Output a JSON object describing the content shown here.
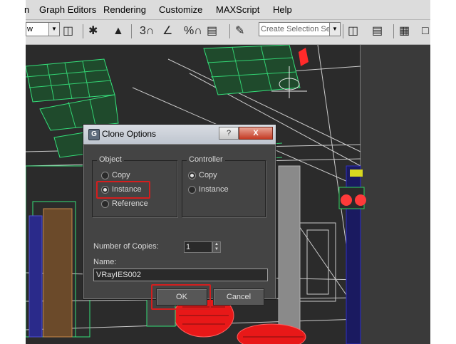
{
  "menu": {
    "items": [
      "n",
      "Graph Editors",
      "Rendering",
      "Customize",
      "MAXScript",
      "Help"
    ]
  },
  "toolbar": {
    "left_dropdown_value": "w",
    "selection_set_value": "Create Selection Se",
    "snap_label": "3",
    "percent_label": "%"
  },
  "dialog": {
    "title": "Clone Options",
    "app_icon_letter": "G",
    "help_glyph": "?",
    "close_glyph": "X",
    "object_group": {
      "label": "Object",
      "options": [
        "Copy",
        "Instance",
        "Reference"
      ],
      "selected": "Instance"
    },
    "controller_group": {
      "label": "Controller",
      "options": [
        "Copy",
        "Instance"
      ],
      "selected": "Copy"
    },
    "copies_label": "Number of Copies:",
    "copies_value": "1",
    "name_label": "Name:",
    "name_value": "VRayIES002",
    "ok_label": "OK",
    "cancel_label": "Cancel"
  },
  "colors": {
    "wire_green": "#35e07a",
    "wire_white": "#e8e8e8",
    "wire_red": "#ff2a2a",
    "highlight_red": "#d41e1e",
    "viewport_bg": "#2b2b2b",
    "dialog_bg": "#444444"
  },
  "icons": {
    "app_icon": "3dsmax-app-icon",
    "help": "help-icon",
    "close": "close-icon",
    "spinner": "spinner-icon"
  }
}
